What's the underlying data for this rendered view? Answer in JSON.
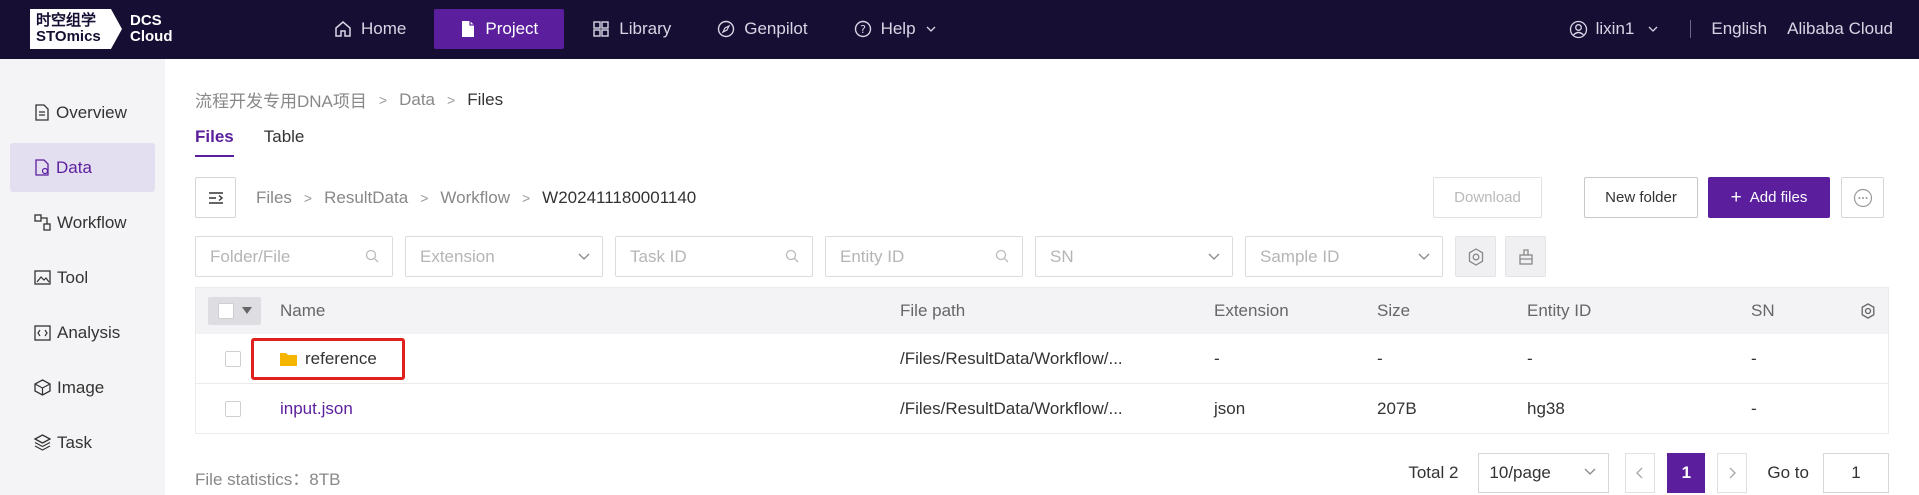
{
  "logo": {
    "line1": "时空组学",
    "line2": "STOmics",
    "brand1": "DCS",
    "brand2": "Cloud"
  },
  "nav": {
    "items": [
      {
        "label": "Home",
        "icon": "home-icon"
      },
      {
        "label": "Project",
        "icon": "file-icon",
        "active": true
      },
      {
        "label": "Library",
        "icon": "grid-icon"
      },
      {
        "label": "Genpilot",
        "icon": "compass-icon"
      },
      {
        "label": "Help",
        "icon": "help-icon"
      }
    ]
  },
  "topright": {
    "user": "lixin1",
    "language": "English",
    "region": "Alibaba Cloud"
  },
  "sidebar": {
    "items": [
      {
        "label": "Overview",
        "icon": "document-icon"
      },
      {
        "label": "Data",
        "icon": "data-file-icon",
        "active": true
      },
      {
        "label": "Workflow",
        "icon": "workflow-icon"
      },
      {
        "label": "Tool",
        "icon": "image-icon"
      },
      {
        "label": "Analysis",
        "icon": "code-icon"
      },
      {
        "label": "Image",
        "icon": "box-icon"
      },
      {
        "label": "Task",
        "icon": "layers-icon"
      }
    ]
  },
  "breadcrumb": {
    "project": "流程开发专用DNA项目",
    "data": "Data",
    "current": "Files"
  },
  "tabs": [
    {
      "label": "Files",
      "active": true
    },
    {
      "label": "Table"
    }
  ],
  "path": {
    "p1": "Files",
    "p2": "ResultData",
    "p3": "Workflow",
    "p4": "W202411180001140"
  },
  "buttons": {
    "download": "Download",
    "new_folder": "New folder",
    "add_files": "Add files"
  },
  "filters": {
    "folder": "Folder/File",
    "extension": "Extension",
    "task_id": "Task ID",
    "entity_id": "Entity ID",
    "sn": "SN",
    "sample_id": "Sample ID"
  },
  "table": {
    "headers": {
      "name": "Name",
      "path": "File path",
      "ext": "Extension",
      "size": "Size",
      "entity": "Entity ID",
      "sn": "SN"
    },
    "rows": [
      {
        "name": "reference",
        "path": "/Files/ResultData/Workflow/...",
        "ext": "-",
        "size": "-",
        "entity": "-",
        "sn": "-"
      },
      {
        "name": "input.json",
        "path": "/Files/ResultData/Workflow/...",
        "ext": "json",
        "size": "207B",
        "entity": "hg38",
        "sn": "-"
      }
    ]
  },
  "footer": {
    "stats": "File statistics：8TB",
    "total": "Total 2",
    "page_size": "10/page",
    "page": "1",
    "goto_label": "Go to",
    "goto_value": "1"
  },
  "colors": {
    "topbar": "#170f33",
    "accent": "#5b1f9e",
    "highlight": "#e01f1f",
    "folder": "#f5b400"
  }
}
